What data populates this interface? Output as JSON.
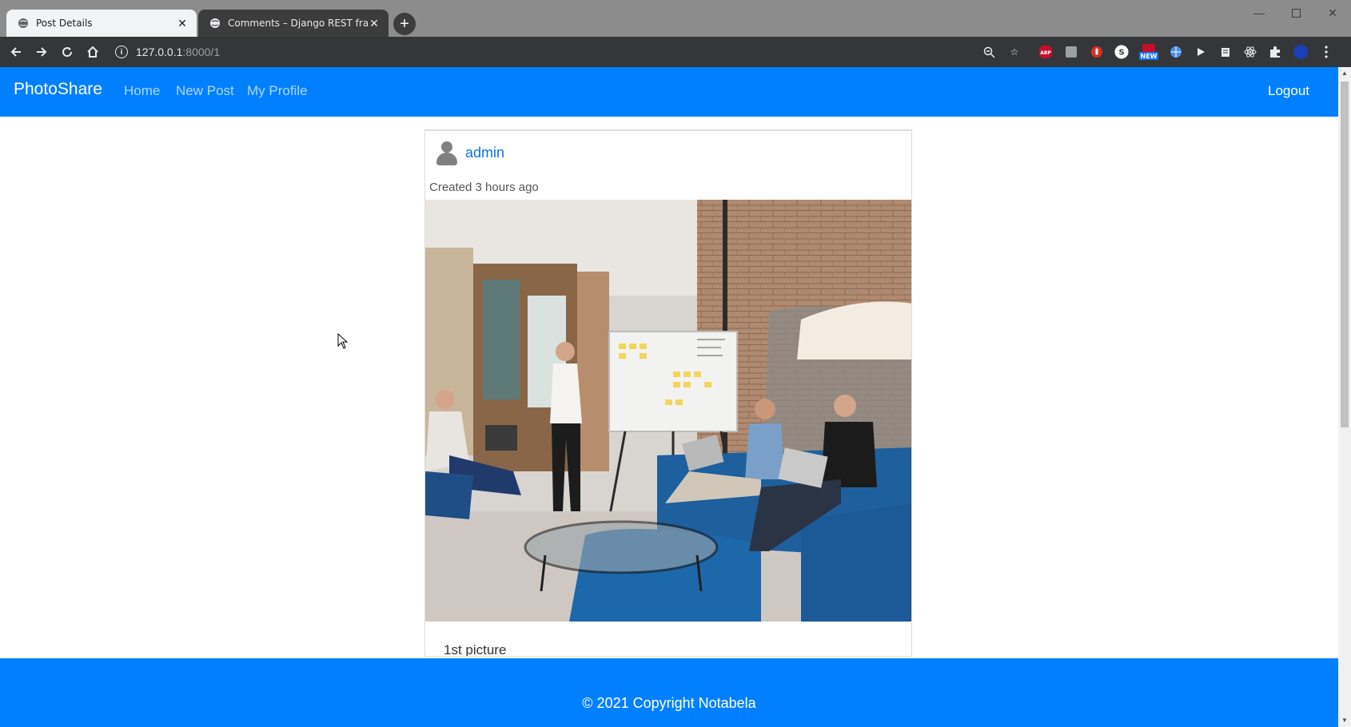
{
  "browser": {
    "tabs": [
      {
        "title": "Post Details",
        "active": true
      },
      {
        "title": "Comments – Django REST frame",
        "active": false
      }
    ],
    "url_host": "127.0.0.1",
    "url_path": ":8000/1",
    "window_controls": [
      "minimize-icon",
      "maximize-icon",
      "close-icon"
    ],
    "extensions": [
      {
        "label": "ABP",
        "color": "#c70d2c"
      },
      {
        "label": "NEW",
        "color": "#1a73e8"
      },
      {
        "label": "S",
        "color": "#ffffff"
      }
    ]
  },
  "navbar": {
    "brand": "PhotoShare",
    "links": [
      "Home",
      "New Post",
      "My Profile"
    ],
    "logout": "Logout",
    "background": "#0080ff"
  },
  "post": {
    "author": "admin",
    "created": "Created 3 hours ago",
    "image_alt": "team meeting in office with whiteboard",
    "caption": "1st picture"
  },
  "footer": {
    "copyright": "© 2021 Copyright Notabela"
  }
}
